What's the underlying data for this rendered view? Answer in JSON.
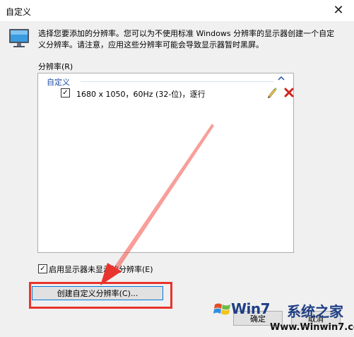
{
  "window": {
    "title": "自定义",
    "close_glyph": "✕"
  },
  "description": "选择您要添加的分辨率。您可以为不使用标准 Windows 分辨率的显示器创建一个自定义分辨率。请注意，应用这些分辨率可能会导致显示器暂时黑屏。",
  "resolution_label": "分辨率(R)",
  "group": {
    "label": "自定义",
    "chevron": "^"
  },
  "items": [
    {
      "checked": true,
      "text": "1680 x 1050，60Hz (32-位)，逐行"
    }
  ],
  "enable_unsupported": {
    "checked": true,
    "label": "启用显示器未显示的分辨率(E)"
  },
  "buttons": {
    "create": "创建自定义分辨率(C)...",
    "ok": "确定",
    "cancel": "取消"
  },
  "watermark": {
    "brand": "Win7",
    "cn": "系统之家",
    "url": "Www.Winwin7.com"
  },
  "colors": {
    "accent_blue": "#1e4da5",
    "highlight_red": "#e8342c",
    "dialog_bg": "#f0f0f0"
  }
}
